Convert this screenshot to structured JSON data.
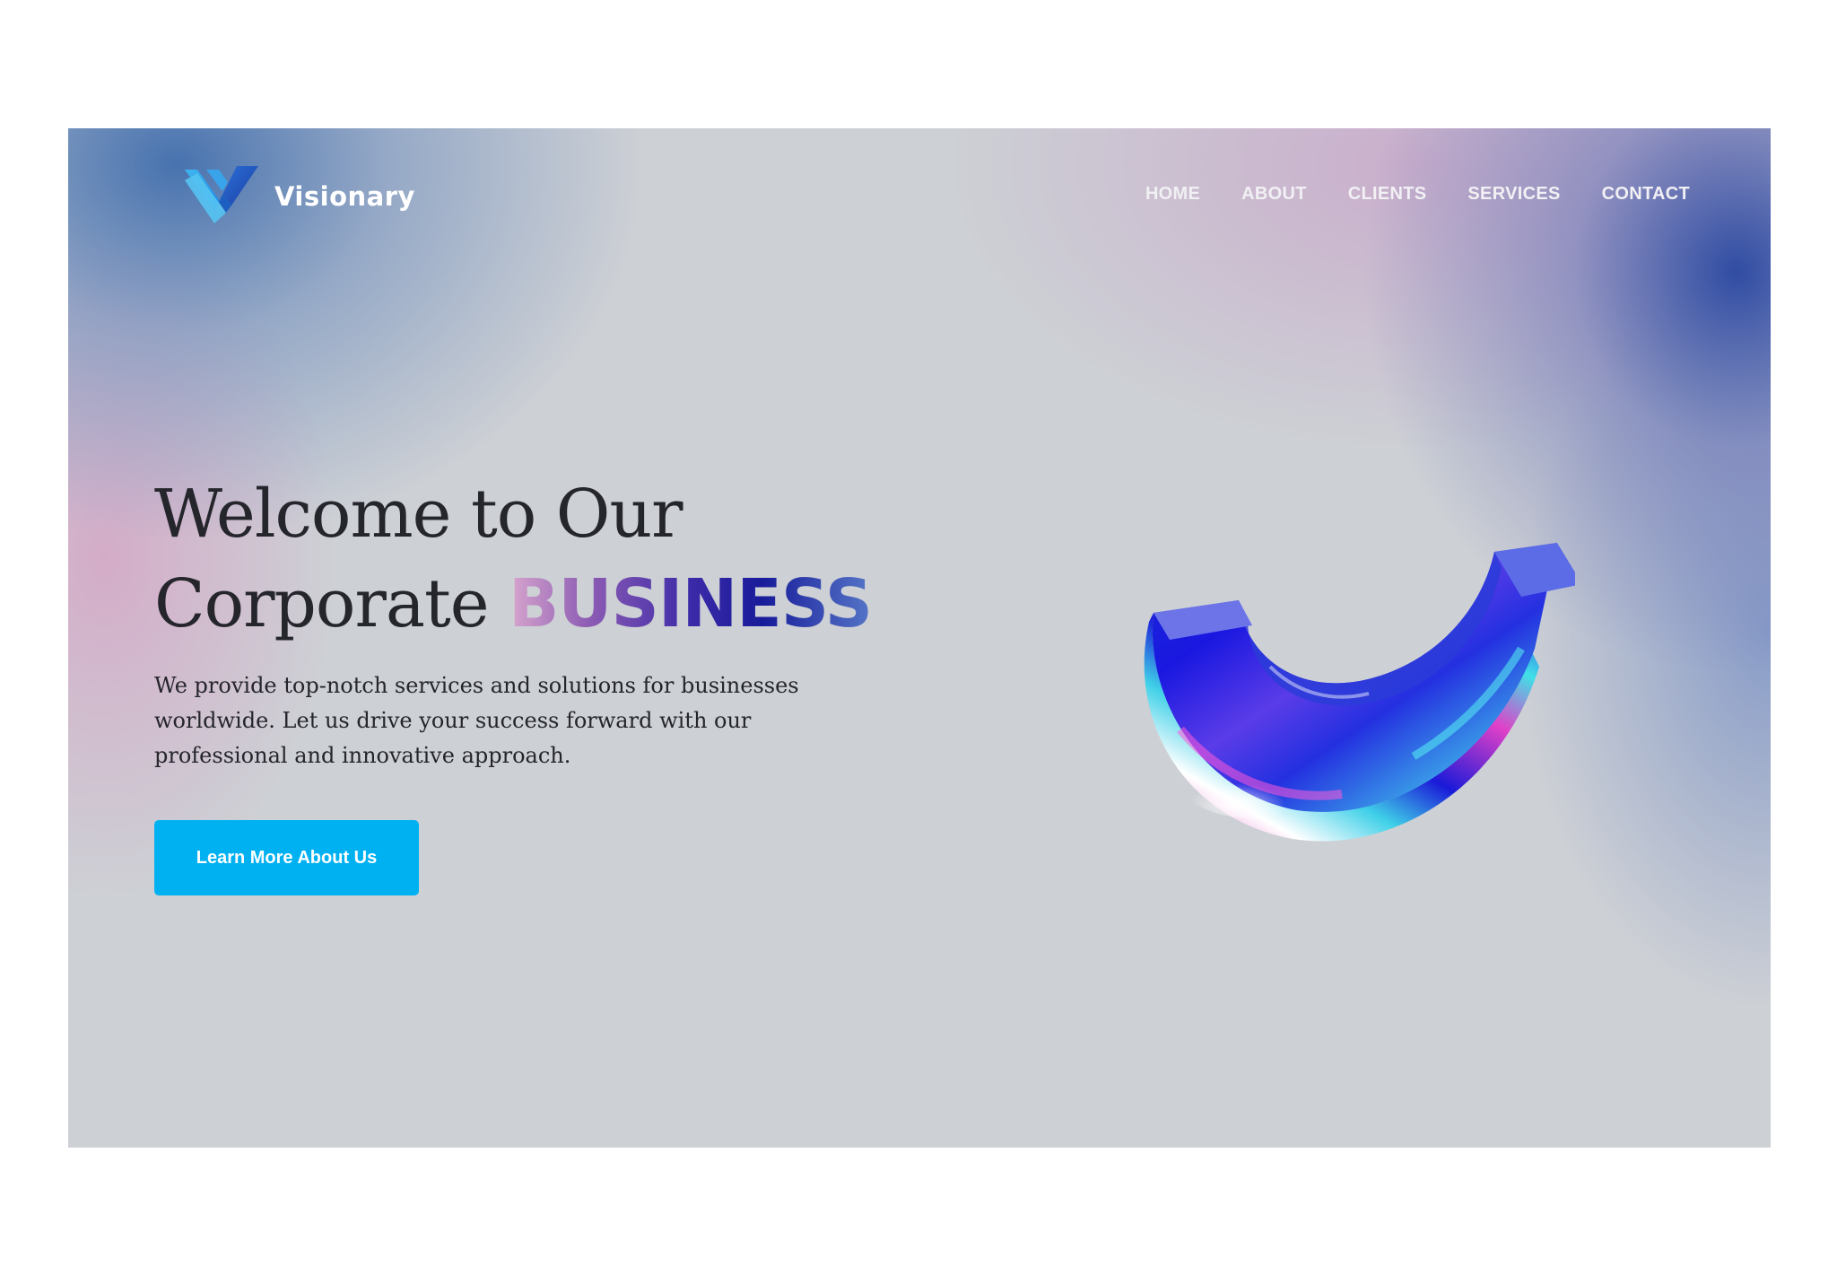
{
  "brand": {
    "name": "Visionary",
    "logo_icon": "visionary-v-logo-icon"
  },
  "nav": {
    "items": [
      {
        "label": "HOME"
      },
      {
        "label": "ABOUT"
      },
      {
        "label": "CLIENTS"
      },
      {
        "label": "SERVICES"
      },
      {
        "label": "CONTACT"
      }
    ]
  },
  "hero": {
    "heading_line1": "Welcome to Our",
    "heading_line2": "Corporate",
    "heading_accent": "BUSINESS",
    "description": "We provide top-notch services and solutions for businesses worldwide. Let us drive your success forward with our professional and innovative approach.",
    "cta_label": "Learn More About Us",
    "illustration": "holographic-arc-3d-shape"
  },
  "colors": {
    "background": "#cdd0d5",
    "cta": "#00b1f2",
    "heading_text": "#25252c",
    "nav_text": "#f1f0f4",
    "accent_start": "#d8a6cd",
    "accent_end": "#5576c8"
  }
}
